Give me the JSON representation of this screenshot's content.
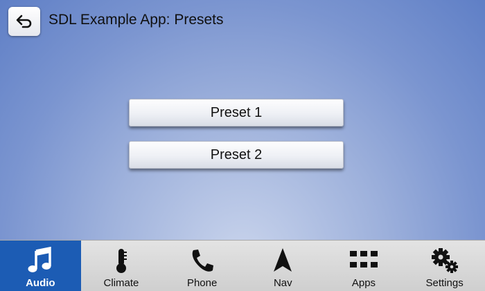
{
  "header": {
    "title": "SDL Example App: Presets",
    "back_icon": "back-arrow-icon"
  },
  "presets": [
    {
      "label": "Preset 1"
    },
    {
      "label": "Preset 2"
    }
  ],
  "tabs": [
    {
      "label": "Audio",
      "icon": "music-note-icon",
      "active": true
    },
    {
      "label": "Climate",
      "icon": "thermometer-icon",
      "active": false
    },
    {
      "label": "Phone",
      "icon": "phone-icon",
      "active": false
    },
    {
      "label": "Nav",
      "icon": "navigation-arrow-icon",
      "active": false
    },
    {
      "label": "Apps",
      "icon": "apps-grid-icon",
      "active": false
    },
    {
      "label": "Settings",
      "icon": "gears-icon",
      "active": false
    }
  ],
  "colors": {
    "active_tab": "#1c5cb4",
    "background": "#7b95d0"
  }
}
